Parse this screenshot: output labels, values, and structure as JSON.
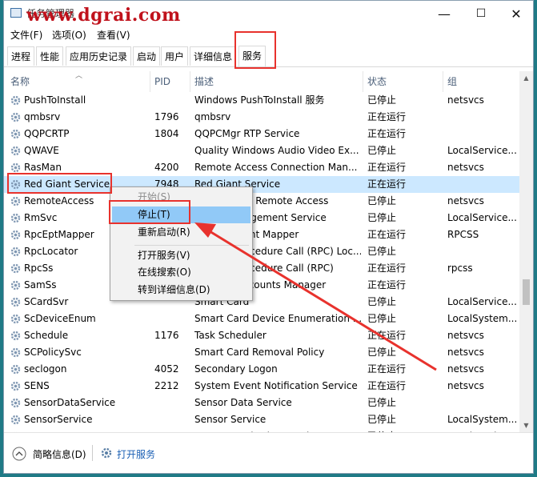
{
  "window": {
    "title": "任务管理器",
    "watermark": "www.dgrai.com"
  },
  "title_buttons": {
    "minimize": "—",
    "maximize": "☐",
    "close": "✕"
  },
  "menu": [
    "文件(F)",
    "选项(O)",
    "查看(V)"
  ],
  "tabs": [
    "进程",
    "性能",
    "应用历史记录",
    "启动",
    "用户",
    "详细信息",
    "服务"
  ],
  "active_tab": "服务",
  "columns": [
    "名称",
    "PID",
    "描述",
    "状态",
    "组"
  ],
  "rows": [
    {
      "name": "PushToInstall",
      "pid": "",
      "desc": "Windows PushToInstall 服务",
      "status": "已停止",
      "group": "netsvcs"
    },
    {
      "name": "qmbsrv",
      "pid": "1796",
      "desc": "qmbsrv",
      "status": "正在运行",
      "group": ""
    },
    {
      "name": "QQPCRTP",
      "pid": "1804",
      "desc": "QQPCMgr RTP Service",
      "status": "正在运行",
      "group": ""
    },
    {
      "name": "QWAVE",
      "pid": "",
      "desc": "Quality Windows Audio Video Ex...",
      "status": "已停止",
      "group": "LocalService..."
    },
    {
      "name": "RasMan",
      "pid": "4200",
      "desc": "Remote Access Connection Man...",
      "status": "正在运行",
      "group": "netsvcs"
    },
    {
      "name": "Red Giant Service",
      "pid": "7948",
      "desc": "Red Giant Service",
      "status": "正在运行",
      "group": ""
    },
    {
      "name": "RemoteAccess",
      "pid": "",
      "desc": "Routing and Remote Access",
      "status": "已停止",
      "group": "netsvcs"
    },
    {
      "name": "RmSvc",
      "pid": "",
      "desc": "Radio Management Service",
      "status": "已停止",
      "group": "LocalService..."
    },
    {
      "name": "RpcEptMapper",
      "pid": "",
      "desc": "RPC Endpoint Mapper",
      "status": "正在运行",
      "group": "RPCSS"
    },
    {
      "name": "RpcLocator",
      "pid": "",
      "desc": "Remote Procedure Call (RPC) Loc...",
      "status": "已停止",
      "group": ""
    },
    {
      "name": "RpcSs",
      "pid": "",
      "desc": "Remote Procedure Call (RPC)",
      "status": "正在运行",
      "group": "rpcss"
    },
    {
      "name": "SamSs",
      "pid": "",
      "desc": "Security Accounts Manager",
      "status": "正在运行",
      "group": ""
    },
    {
      "name": "SCardSvr",
      "pid": "",
      "desc": "Smart Card",
      "status": "已停止",
      "group": "LocalService..."
    },
    {
      "name": "ScDeviceEnum",
      "pid": "",
      "desc": "Smart Card Device Enumeration ...",
      "status": "已停止",
      "group": "LocalSystem..."
    },
    {
      "name": "Schedule",
      "pid": "1176",
      "desc": "Task Scheduler",
      "status": "正在运行",
      "group": "netsvcs"
    },
    {
      "name": "SCPolicySvc",
      "pid": "",
      "desc": "Smart Card Removal Policy",
      "status": "已停止",
      "group": "netsvcs"
    },
    {
      "name": "seclogon",
      "pid": "4052",
      "desc": "Secondary Logon",
      "status": "正在运行",
      "group": "netsvcs"
    },
    {
      "name": "SENS",
      "pid": "2212",
      "desc": "System Event Notification Service",
      "status": "正在运行",
      "group": "netsvcs"
    },
    {
      "name": "SensorDataService",
      "pid": "",
      "desc": "Sensor Data Service",
      "status": "已停止",
      "group": ""
    },
    {
      "name": "SensorService",
      "pid": "",
      "desc": "Sensor Service",
      "status": "已停止",
      "group": "LocalSystem..."
    },
    {
      "name": "SensrSvc",
      "pid": "",
      "desc": "Sensor Monitoring Service",
      "status": "已停止",
      "group": "LocalService..."
    }
  ],
  "context_menu": {
    "items": [
      "开始(S)",
      "停止(T)",
      "重新启动(R)",
      "打开服务(V)",
      "在线搜索(O)",
      "转到详细信息(D)"
    ]
  },
  "footer": {
    "less_details": "简略信息(D)",
    "open_services": "打开服务"
  },
  "colors": {
    "highlight_box": "#e8322d",
    "selected_row": "#cce8ff",
    "menu_hover": "#91c9f7"
  }
}
